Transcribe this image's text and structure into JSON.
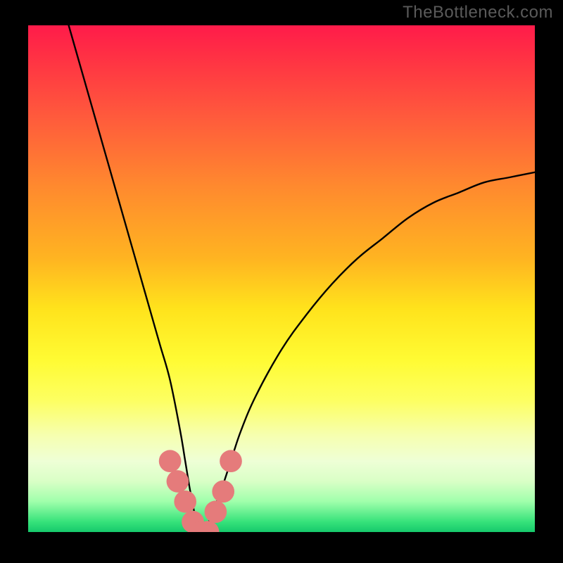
{
  "watermark": "TheBottleneck.com",
  "chart_data": {
    "type": "line",
    "title": "",
    "xlabel": "",
    "ylabel": "",
    "xlim": [
      0,
      100
    ],
    "ylim": [
      0,
      100
    ],
    "series": [
      {
        "name": "bottleneck-curve",
        "x": [
          8,
          10,
          12,
          14,
          16,
          18,
          20,
          22,
          24,
          26,
          28,
          30,
          31,
          32,
          33,
          34,
          35,
          36,
          38,
          40,
          42,
          45,
          50,
          55,
          60,
          65,
          70,
          75,
          80,
          85,
          90,
          95,
          100
        ],
        "values": [
          100,
          93,
          86,
          79,
          72,
          65,
          58,
          51,
          44,
          37,
          30,
          20,
          14,
          8,
          3,
          0,
          0,
          3,
          8,
          14,
          20,
          27,
          36,
          43,
          49,
          54,
          58,
          62,
          65,
          67,
          69,
          70,
          71
        ]
      }
    ],
    "markers": {
      "name": "highlighted-points",
      "color": "#e57b7b",
      "radius": 2.2,
      "x": [
        28,
        29.5,
        31,
        32.5,
        34,
        35.5,
        37,
        38.5,
        40
      ],
      "values": [
        14,
        10,
        6,
        2,
        0,
        0,
        4,
        8,
        14
      ]
    },
    "colors": {
      "curve": "#000000",
      "gradient_top": "#ff1b4a",
      "gradient_bottom": "#16c96c"
    }
  }
}
